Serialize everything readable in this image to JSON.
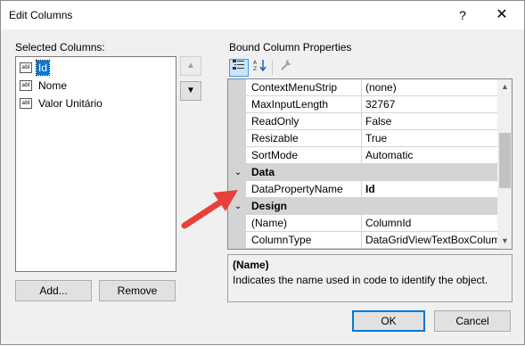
{
  "window": {
    "title": "Edit Columns",
    "help_glyph": "?",
    "close_glyph": "✕"
  },
  "selected_columns": {
    "label": "Selected Columns:",
    "items": [
      {
        "icon": "abl",
        "label": "Id",
        "selected": true
      },
      {
        "icon": "abl",
        "label": "Nome",
        "selected": false
      },
      {
        "icon": "abl",
        "label": "Valor Unitário",
        "selected": false
      }
    ],
    "move_up_glyph": "▲",
    "move_down_glyph": "▼",
    "add_label": "Add...",
    "remove_label": "Remove"
  },
  "properties": {
    "label": "Bound Column Properties",
    "toolbar": {
      "categorized_icon": "categorized-icon",
      "alphabetical_icon": "alphabetical-icon",
      "property-pages-icon": "wrench-icon"
    },
    "rows": [
      {
        "type": "property",
        "name": "ContextMenuStrip",
        "value": "(none)"
      },
      {
        "type": "property",
        "name": "MaxInputLength",
        "value": "32767"
      },
      {
        "type": "property",
        "name": "ReadOnly",
        "value": "False"
      },
      {
        "type": "property",
        "name": "Resizable",
        "value": "True"
      },
      {
        "type": "property",
        "name": "SortMode",
        "value": "Automatic"
      },
      {
        "type": "category",
        "name": "Data"
      },
      {
        "type": "property",
        "name": "DataPropertyName",
        "value": "Id",
        "bold": true
      },
      {
        "type": "category",
        "name": "Design"
      },
      {
        "type": "property",
        "name": "(Name)",
        "value": "ColumnId"
      },
      {
        "type": "property",
        "name": "ColumnType",
        "value": "DataGridViewTextBoxColum"
      }
    ],
    "help": {
      "title": "(Name)",
      "description": "Indicates the name used in code to identify the object."
    }
  },
  "footer": {
    "ok_label": "OK",
    "cancel_label": "Cancel"
  },
  "colors": {
    "selection": "#0078d7",
    "annotation_arrow": "#e8413a"
  }
}
